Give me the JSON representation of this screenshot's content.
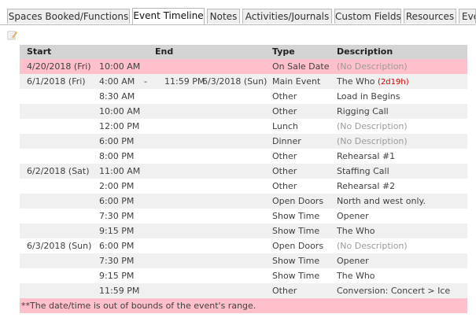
{
  "tabs": [
    {
      "label": "Spaces Booked/Functions",
      "active": false
    },
    {
      "label": "Event Timeline",
      "active": true
    },
    {
      "label": "Notes",
      "active": false
    },
    {
      "label": "Activities/Journals",
      "active": false
    },
    {
      "label": "Custom Fields",
      "active": false
    },
    {
      "label": "Resources",
      "active": false
    },
    {
      "label": "Eve",
      "active": false
    }
  ],
  "edit_icon": "pencil-note-icon",
  "colors": {
    "out_of_range_highlight": "#ffc0cb",
    "header_background": "#d4d4d4",
    "duration_red": "#d40000"
  },
  "table": {
    "headers": {
      "start": "Start",
      "end": "End",
      "type": "Type",
      "description": "Description"
    },
    "rows": [
      {
        "date": "4/20/2018 (Fri)",
        "start": "10:00 AM",
        "dash": "",
        "end_time": "",
        "end_date": "",
        "type": "On Sale Date",
        "description": "(No Description)",
        "duration": "",
        "highlight": true
      },
      {
        "date": "6/1/2018 (Fri)",
        "start": "4:00 AM",
        "dash": "-",
        "end_time": "11:59 PM",
        "end_date": "6/3/2018 (Sun)",
        "type": "Main Event",
        "description": "The Who",
        "duration": "(2d19h)",
        "highlight": false
      },
      {
        "date": "",
        "start": "8:30 AM",
        "dash": "",
        "end_time": "",
        "end_date": "",
        "type": "Other",
        "description": "Load in Begins",
        "duration": "",
        "highlight": false
      },
      {
        "date": "",
        "start": "10:00 AM",
        "dash": "",
        "end_time": "",
        "end_date": "",
        "type": "Other",
        "description": "Rigging Call",
        "duration": "",
        "highlight": false
      },
      {
        "date": "",
        "start": "12:00 PM",
        "dash": "",
        "end_time": "",
        "end_date": "",
        "type": "Lunch",
        "description": "(No Description)",
        "duration": "",
        "highlight": false
      },
      {
        "date": "",
        "start": "6:00 PM",
        "dash": "",
        "end_time": "",
        "end_date": "",
        "type": "Dinner",
        "description": "(No Description)",
        "duration": "",
        "highlight": false
      },
      {
        "date": "",
        "start": "8:00 PM",
        "dash": "",
        "end_time": "",
        "end_date": "",
        "type": "Other",
        "description": "Rehearsal #1",
        "duration": "",
        "highlight": false
      },
      {
        "date": "6/2/2018 (Sat)",
        "start": "11:00 AM",
        "dash": "",
        "end_time": "",
        "end_date": "",
        "type": "Other",
        "description": "Staffing Call",
        "duration": "",
        "highlight": false
      },
      {
        "date": "",
        "start": "2:00 PM",
        "dash": "",
        "end_time": "",
        "end_date": "",
        "type": "Other",
        "description": "Rehearsal #2",
        "duration": "",
        "highlight": false
      },
      {
        "date": "",
        "start": "6:00 PM",
        "dash": "",
        "end_time": "",
        "end_date": "",
        "type": "Open Doors",
        "description": "North and west only.",
        "duration": "",
        "highlight": false
      },
      {
        "date": "",
        "start": "7:30 PM",
        "dash": "",
        "end_time": "",
        "end_date": "",
        "type": "Show Time",
        "description": "Opener",
        "duration": "",
        "highlight": false
      },
      {
        "date": "",
        "start": "9:15 PM",
        "dash": "",
        "end_time": "",
        "end_date": "",
        "type": "Show Time",
        "description": "The Who",
        "duration": "",
        "highlight": false
      },
      {
        "date": "6/3/2018 (Sun)",
        "start": "6:00 PM",
        "dash": "",
        "end_time": "",
        "end_date": "",
        "type": "Open Doors",
        "description": "(No Description)",
        "duration": "",
        "highlight": false
      },
      {
        "date": "",
        "start": "7:30 PM",
        "dash": "",
        "end_time": "",
        "end_date": "",
        "type": "Show Time",
        "description": "Opener",
        "duration": "",
        "highlight": false
      },
      {
        "date": "",
        "start": "9:15 PM",
        "dash": "",
        "end_time": "",
        "end_date": "",
        "type": "Show Time",
        "description": "The Who",
        "duration": "",
        "highlight": false
      },
      {
        "date": "",
        "start": "11:59 PM",
        "dash": "",
        "end_time": "",
        "end_date": "",
        "type": "Other",
        "description": "Conversion: Concert > Ice",
        "duration": "",
        "highlight": false
      }
    ],
    "footnote": "**The date/time is out of bounds of the event's range."
  }
}
